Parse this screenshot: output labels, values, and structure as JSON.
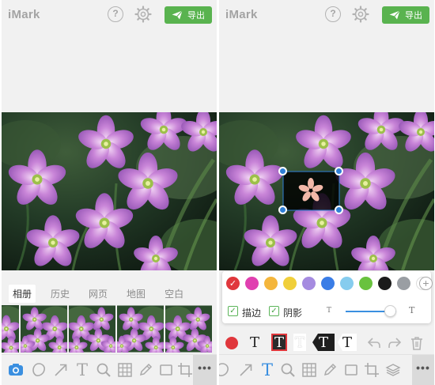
{
  "app": {
    "name": "iMark"
  },
  "header": {
    "help_glyph": "?",
    "export_label": "导出"
  },
  "tabs": [
    {
      "label": "相册",
      "active": true
    },
    {
      "label": "历史",
      "active": false
    },
    {
      "label": "网页",
      "active": false
    },
    {
      "label": "地图",
      "active": false
    },
    {
      "label": "空白",
      "active": false
    }
  ],
  "text_tool_glyph": "T",
  "more_glyph": "•••",
  "colors": {
    "accent_green": "#59b34f",
    "active_tool_blue": "#3a8fe0",
    "handle_blue": "#2f7fd6"
  },
  "palette": [
    {
      "hex": "#e0373c",
      "selected": true
    },
    {
      "hex": "#e040b0",
      "selected": false
    },
    {
      "hex": "#f4b63c",
      "selected": false
    },
    {
      "hex": "#f0cf3a",
      "selected": false
    },
    {
      "hex": "#a58be0",
      "selected": false
    },
    {
      "hex": "#3a7de6",
      "selected": false
    },
    {
      "hex": "#86ccee",
      "selected": false
    },
    {
      "hex": "#69c23e",
      "selected": false
    },
    {
      "hex": "#1b1b1b",
      "selected": false
    },
    {
      "hex": "#9a9ea3",
      "selected": false
    },
    {
      "hex": "#ffffff",
      "selected": false
    }
  ],
  "add_color_glyph": "+",
  "check_glyph": "✓",
  "options": {
    "stroke_label": "描边",
    "stroke_checked": true,
    "shadow_label": "阴影",
    "shadow_checked": true,
    "size_small_glyph": "T",
    "size_large_glyph": "T",
    "size_level": 0.88
  },
  "text_styles": [
    {
      "name": "plain",
      "glyph": "T"
    },
    {
      "name": "red-outline",
      "glyph": "T"
    },
    {
      "name": "white-block",
      "glyph": "T"
    },
    {
      "name": "black-tag",
      "glyph": "T"
    },
    {
      "name": "white-tag",
      "glyph": "T"
    }
  ],
  "icons": [
    "question-icon",
    "gear-icon",
    "send-icon",
    "camera-icon",
    "shape-icon",
    "arrow-icon",
    "text-icon",
    "magnifier-icon",
    "mosaic-icon",
    "pen-icon",
    "rectangle-icon",
    "crop-icon",
    "layers-icon",
    "undo-icon",
    "redo-icon",
    "trash-icon",
    "flower-logo-icon"
  ]
}
